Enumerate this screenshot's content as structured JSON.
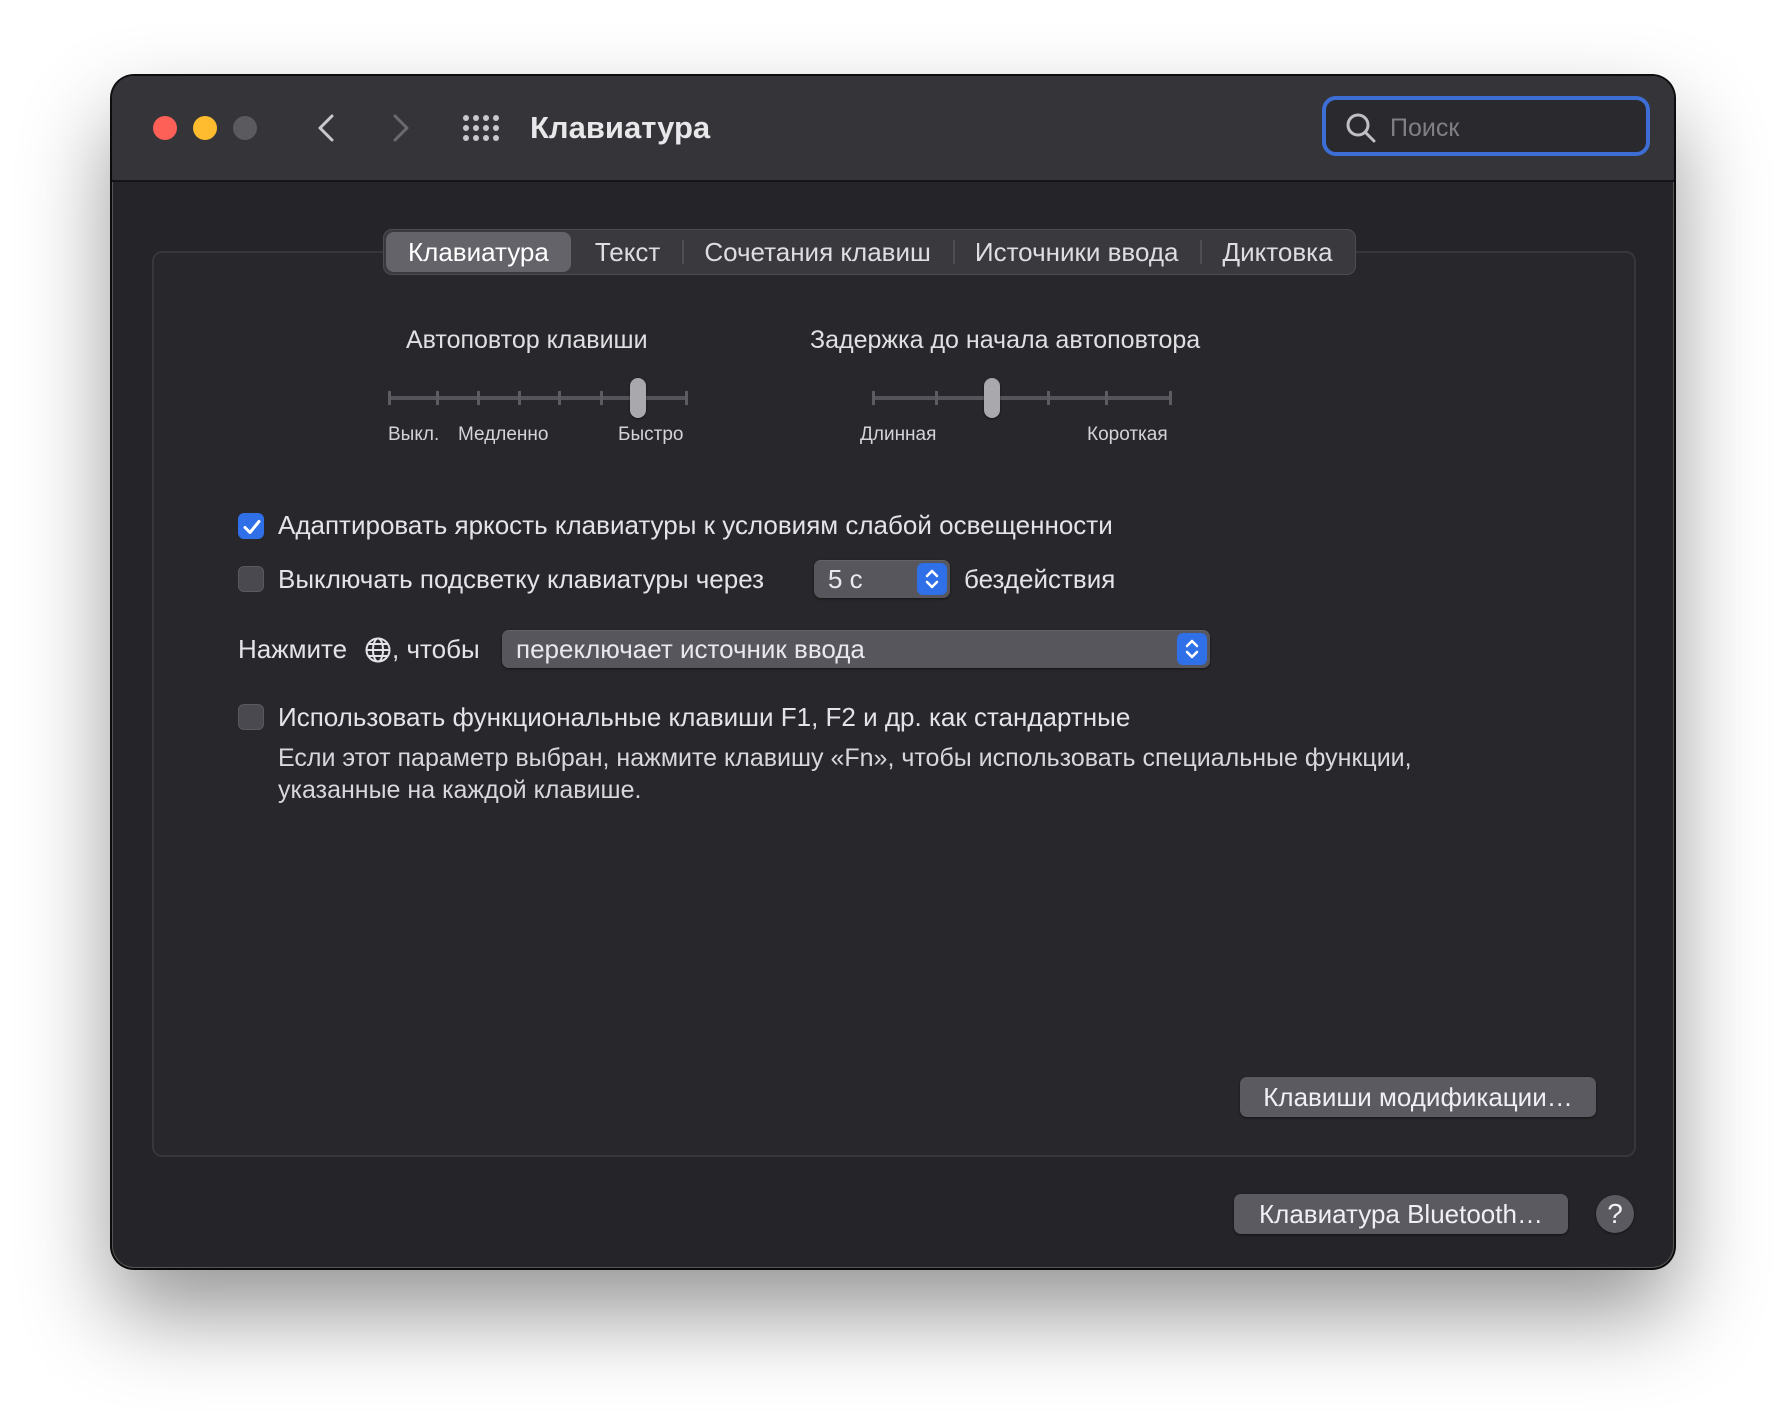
{
  "window": {
    "title": "Клавиатура",
    "search_placeholder": "Поиск"
  },
  "tabs": [
    {
      "label": "Клавиатура",
      "active": true
    },
    {
      "label": "Текст",
      "active": false
    },
    {
      "label": "Сочетания клавиш",
      "active": false
    },
    {
      "label": "Источники ввода",
      "active": false
    },
    {
      "label": "Диктовка",
      "active": false
    }
  ],
  "key_repeat": {
    "title": "Автоповтор клавиши",
    "labels": [
      "Выкл.",
      "Медленно",
      "Быстро"
    ],
    "position_step": 6,
    "steps": 8
  },
  "repeat_delay": {
    "title": "Задержка до начала автоповтора",
    "labels": [
      "Длинная",
      "Короткая"
    ],
    "position_step": 2,
    "steps": 6
  },
  "options": {
    "adjust_brightness": {
      "label": "Адаптировать яркость клавиатуры к условиям слабой освещенности",
      "checked": true
    },
    "backlight_off": {
      "label": "Выключать подсветку клавиатуры через",
      "checked": false,
      "value": "5 с",
      "suffix": "бездействия"
    },
    "globe": {
      "label_before": "Нажмите",
      "label_after": ", чтобы",
      "value": "переключает источник ввода"
    },
    "fn_keys": {
      "label": "Использовать функциональные клавиши F1, F2 и др. как стандартные",
      "checked": false,
      "note": "Если этот параметр выбран, нажмите клавишу «Fn», чтобы использовать специальные функции, указанные на каждой клавише."
    }
  },
  "buttons": {
    "modifier_keys": "Клавиши модификации…",
    "bluetooth_keyboard": "Клавиатура Bluetooth…",
    "help": "?"
  },
  "colors": {
    "accent": "#2f6fe8",
    "close": "#fe5f57",
    "minimize": "#febc2e",
    "window_bg": "#252428"
  }
}
